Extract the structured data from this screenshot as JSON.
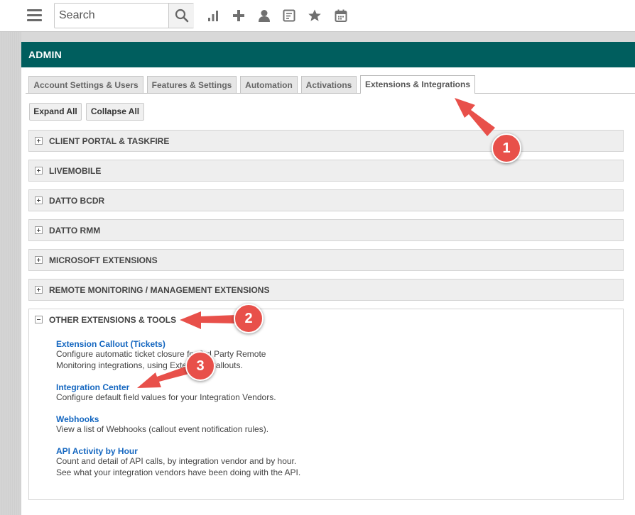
{
  "topbar": {
    "search_placeholder": "Search",
    "icons": [
      "menu-icon",
      "search-icon",
      "chart-icon",
      "plus-icon",
      "user-icon",
      "invoice-icon",
      "star-icon",
      "calendar-icon"
    ]
  },
  "admin": {
    "title": "ADMIN"
  },
  "tabs": [
    {
      "label": "Account Settings & Users"
    },
    {
      "label": "Features & Settings"
    },
    {
      "label": "Automation"
    },
    {
      "label": "Activations"
    },
    {
      "label": "Extensions & Integrations",
      "active": true
    }
  ],
  "buttons": {
    "expand_all": "Expand All",
    "collapse_all": "Collapse All"
  },
  "sections": [
    {
      "title": "CLIENT PORTAL & TASKFIRE"
    },
    {
      "title": "LIVEMOBILE"
    },
    {
      "title": "DATTO BCDR"
    },
    {
      "title": "DATTO RMM"
    },
    {
      "title": "MICROSOFT EXTENSIONS"
    },
    {
      "title": "REMOTE MONITORING / MANAGEMENT EXTENSIONS"
    }
  ],
  "open_section": {
    "title": "OTHER EXTENSIONS & TOOLS",
    "items": [
      {
        "link": "Extension Callout (Tickets)",
        "desc1": "Configure automatic ticket closure for 3rd Party Remote",
        "desc2": "Monitoring integrations, using Extension Callouts."
      },
      {
        "link": "Integration Center",
        "desc1": "Configure default field values for your Integration Vendors."
      },
      {
        "link": "Webhooks",
        "desc1": "View a list of Webhooks (callout event notification rules)."
      },
      {
        "link": "API Activity by Hour",
        "desc1": "Count and detail of API calls, by integration vendor and by hour.",
        "desc2": "See what your integration vendors have been doing with the API."
      }
    ]
  },
  "callouts": [
    "1",
    "2",
    "3"
  ],
  "colors": {
    "admin_bar": "#005e5e",
    "link": "#1567c0",
    "callout": "#e8504a"
  }
}
